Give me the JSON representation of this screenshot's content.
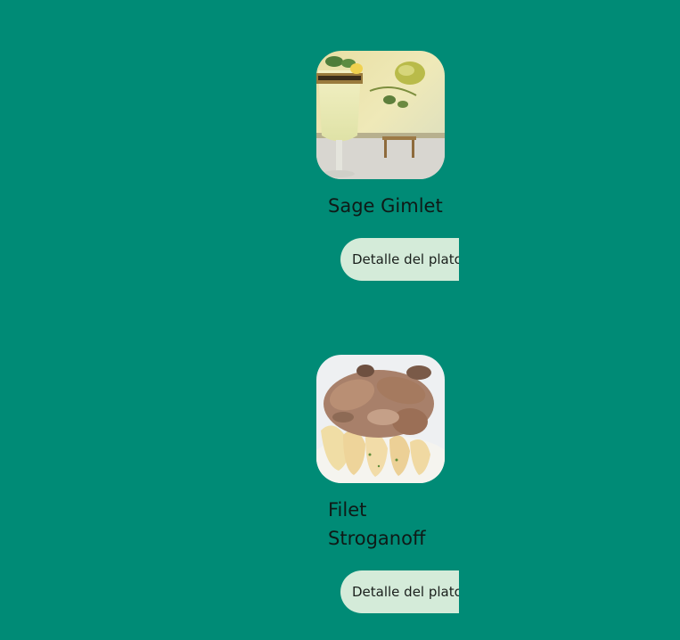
{
  "dishes": [
    {
      "name": "Sage Gimlet",
      "button_label": "Detalle del plato",
      "image": "cocktail-photo"
    },
    {
      "name": "Filet Stroganoff",
      "button_label": "Detalle del plato",
      "image": "stroganoff-photo"
    }
  ],
  "colors": {
    "background": "#008b76",
    "button_bg": "#d4ebd9",
    "text": "#0f1a17"
  }
}
